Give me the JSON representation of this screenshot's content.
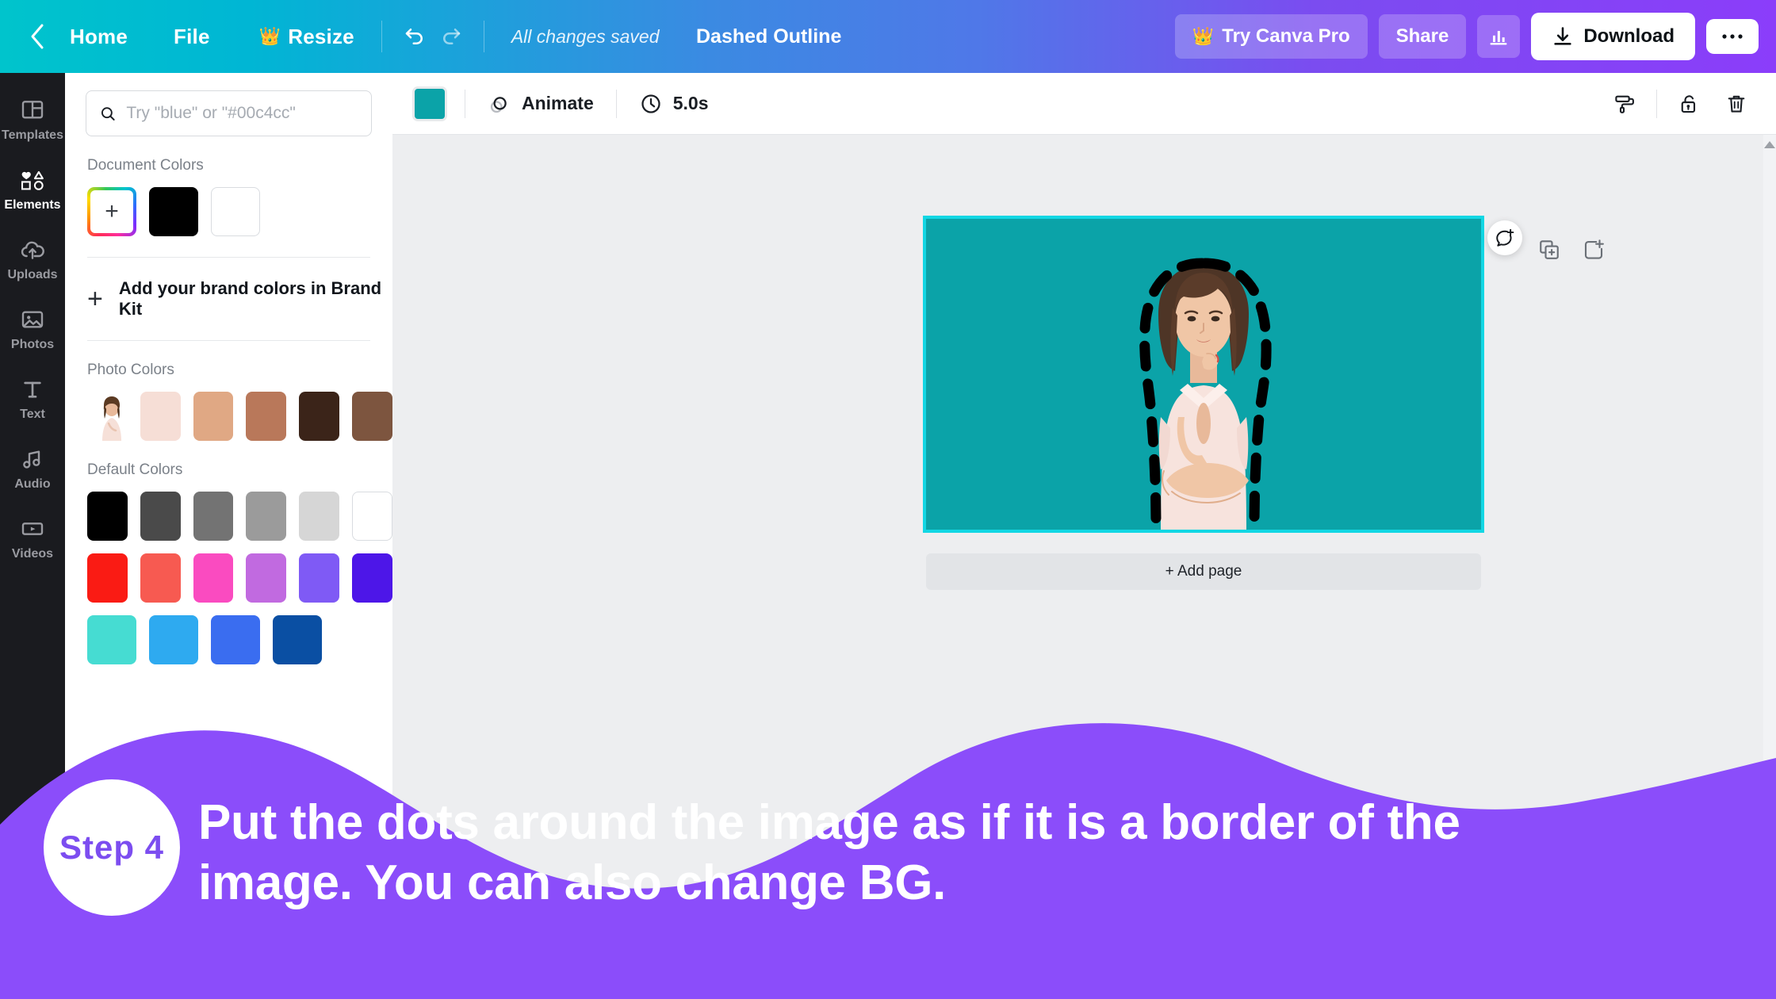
{
  "topbar": {
    "back_icon": "chevron-left-icon",
    "home": "Home",
    "file": "File",
    "resize": "Resize",
    "resize_icon": "crown-icon",
    "undo_icon": "undo-icon",
    "redo_icon": "redo-icon",
    "save_status": "All changes saved",
    "doc_title": "Dashed Outline",
    "try_pro": "Try Canva Pro",
    "try_pro_icon": "crown-icon",
    "share": "Share",
    "insights_icon": "bar-chart-icon",
    "download": "Download",
    "download_icon": "download-icon",
    "more_icon": "ellipsis-icon",
    "gradient_start": "#00c4cc",
    "gradient_end": "#8b3dfa"
  },
  "sidebar": {
    "items": [
      {
        "label": "Templates",
        "icon": "templates-icon",
        "active": false
      },
      {
        "label": "Elements",
        "icon": "elements-icon",
        "active": true
      },
      {
        "label": "Uploads",
        "icon": "uploads-icon",
        "active": false
      },
      {
        "label": "Photos",
        "icon": "photos-icon",
        "active": false
      },
      {
        "label": "Text",
        "icon": "text-icon",
        "active": false
      },
      {
        "label": "Audio",
        "icon": "audio-icon",
        "active": false
      },
      {
        "label": "Videos",
        "icon": "videos-icon",
        "active": false
      }
    ]
  },
  "panel": {
    "search_placeholder": "Try \"blue\" or \"#00c4cc\"",
    "search_value": "",
    "search_icon": "search-icon",
    "document_colors_title": "Document Colors",
    "document_colors": [
      "picker",
      "#000000",
      "#ffffff"
    ],
    "brandkit_label": "Add your brand colors in Brand Kit",
    "brandkit_icon": "plus-icon",
    "photo_colors_title": "Photo Colors",
    "photo_colors": [
      "#f6ded6",
      "#e0a884",
      "#b9785a",
      "#3b2419",
      "#7d553f"
    ],
    "default_colors_title": "Default Colors",
    "default_colors": [
      [
        "#000000",
        "#4a4a4a",
        "#737373",
        "#9b9b9b",
        "#d6d6d6",
        "#ffffff"
      ],
      [
        "#fa1b14",
        "#f75a51",
        "#fa4bc0",
        "#c16ae0",
        "#7f5af5",
        "#4d16e8"
      ],
      [
        "#46dcd2",
        "#2eaaf0",
        "#3a6df0",
        "#0a4fa3"
      ]
    ]
  },
  "canvas_toolbar": {
    "color_swatch": "#0ba3a8",
    "animate_label": "Animate",
    "animate_icon": "animate-icon",
    "duration_label": "5.0s",
    "duration_icon": "clock-icon",
    "copy_style_icon": "paint-roller-icon",
    "lock_icon": "unlock-icon",
    "delete_icon": "trash-icon"
  },
  "canvas": {
    "background_color": "#0ba3a8",
    "selection_color": "#12d7e4",
    "duplicate_page_icon": "duplicate-page-icon",
    "add_page_icon": "add-page-icon",
    "comment_icon": "add-comment-icon",
    "add_page_label": "+ Add page",
    "outline_color": "#000000",
    "outline_style": "dashed"
  },
  "overlay": {
    "step_label": "Step 4",
    "caption": "Put the dots around the image as if it is a border of the image. You can also change BG.",
    "wave_color": "#8b4dfa"
  }
}
